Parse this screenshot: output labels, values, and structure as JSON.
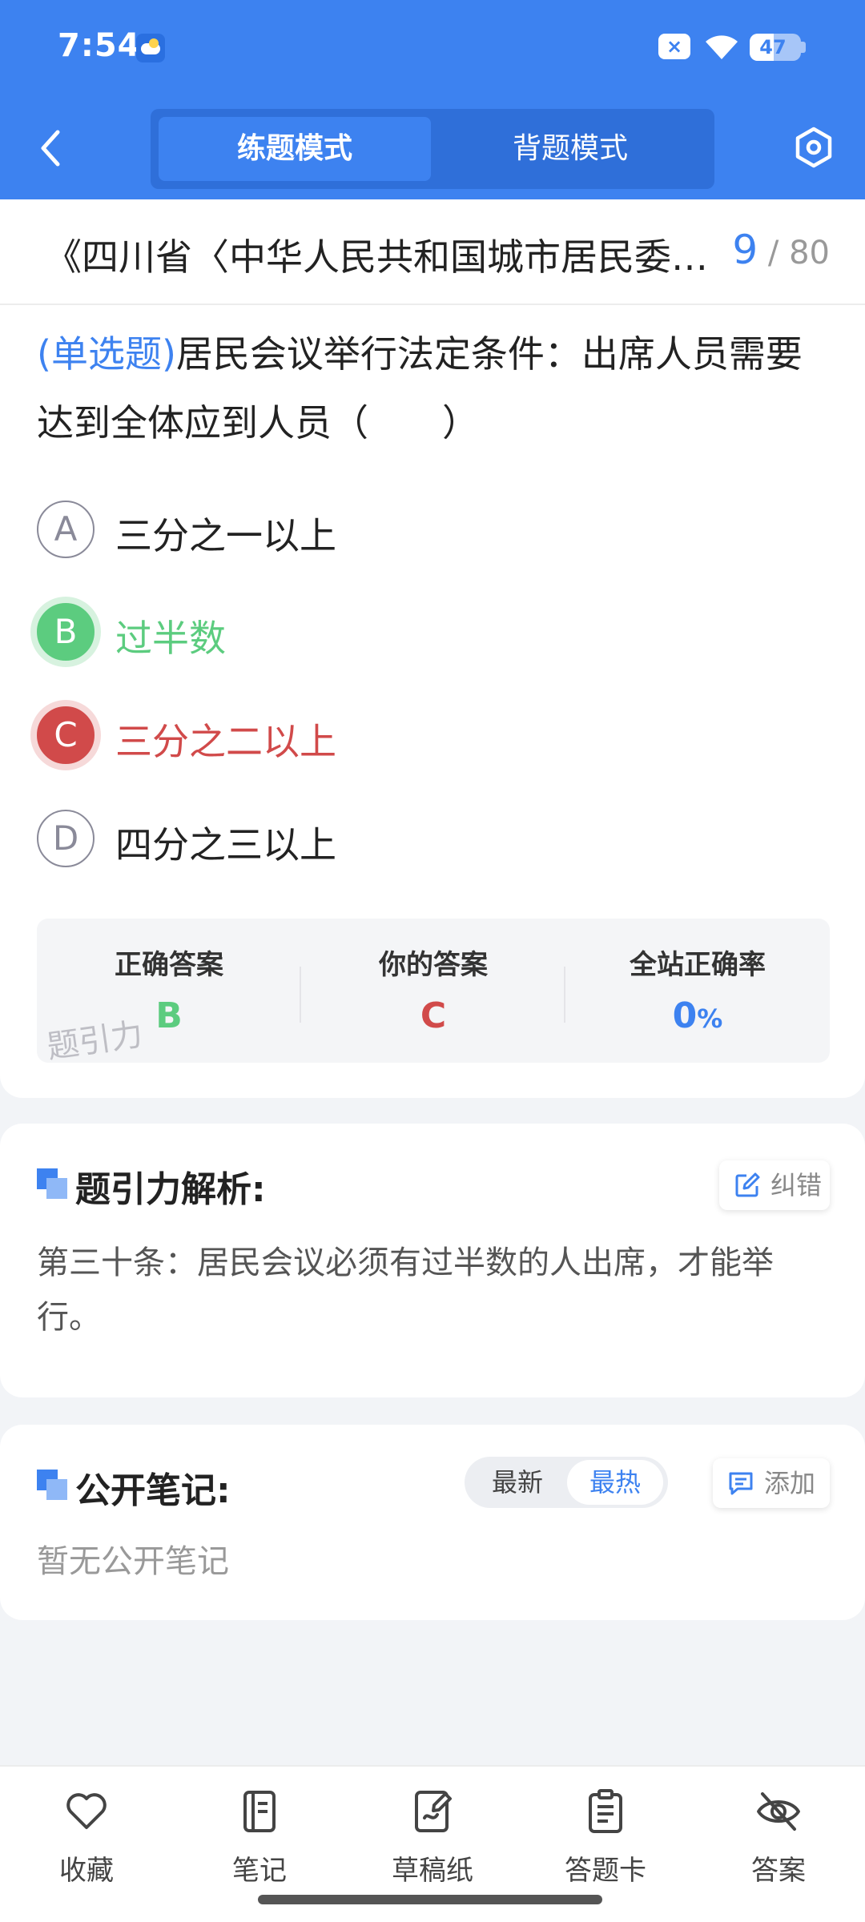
{
  "status_bar": {
    "time": "7:54",
    "battery": "47",
    "battery_level": 0.47,
    "icons": [
      "weather-icon",
      "close-box-icon",
      "wifi-icon",
      "battery-icon"
    ]
  },
  "header": {
    "back_icon": "chevron-left-icon",
    "modes": [
      "练题模式",
      "背题模式"
    ],
    "active_mode": "练题模式",
    "settings_icon": "settings-hex-icon",
    "colors": {
      "primary": "#3d82f0",
      "primary_dark": "#2f6fd9"
    }
  },
  "question": {
    "title": "《四川省〈中华人民共和国城市居民委员会组织法〉实施办法》",
    "current": "9",
    "total": "/ 80",
    "type": "(单选题)",
    "text": "居民会议举行法定条件：出席人员需要达到全体应到人员（　　）",
    "options": [
      {
        "letter": "A",
        "text": "三分之一以上",
        "state": "normal"
      },
      {
        "letter": "B",
        "text": "过半数",
        "state": "correct"
      },
      {
        "letter": "C",
        "text": "三分之二以上",
        "state": "wrong"
      },
      {
        "letter": "D",
        "text": "四分之三以上",
        "state": "normal"
      }
    ],
    "colors": {
      "correct": "#5ccc7f",
      "wrong": "#d14a4a"
    }
  },
  "answer_summary": {
    "correct_label": "正确答案",
    "correct_value": "B",
    "yours_label": "你的答案",
    "yours_value": "C",
    "rate_label": "全站正确率",
    "rate_value": "0",
    "rate_unit": "%",
    "watermark": "题引力"
  },
  "analysis": {
    "title": "题引力解析:",
    "report_button": "纠错",
    "text": "第三十条：居民会议必须有过半数的人出席，才能举行。"
  },
  "notes": {
    "title": "公开笔记:",
    "sort_options": [
      "最新",
      "最热"
    ],
    "active_sort": "最热",
    "add_button": "添加",
    "empty_text": "暂无公开笔记"
  },
  "bottom_nav": [
    {
      "label": "收藏",
      "icon": "heart-icon"
    },
    {
      "label": "笔记",
      "icon": "notebook-icon"
    },
    {
      "label": "草稿纸",
      "icon": "draft-paper-icon"
    },
    {
      "label": "答题卡",
      "icon": "answer-card-icon"
    },
    {
      "label": "答案",
      "icon": "eye-off-icon"
    }
  ]
}
